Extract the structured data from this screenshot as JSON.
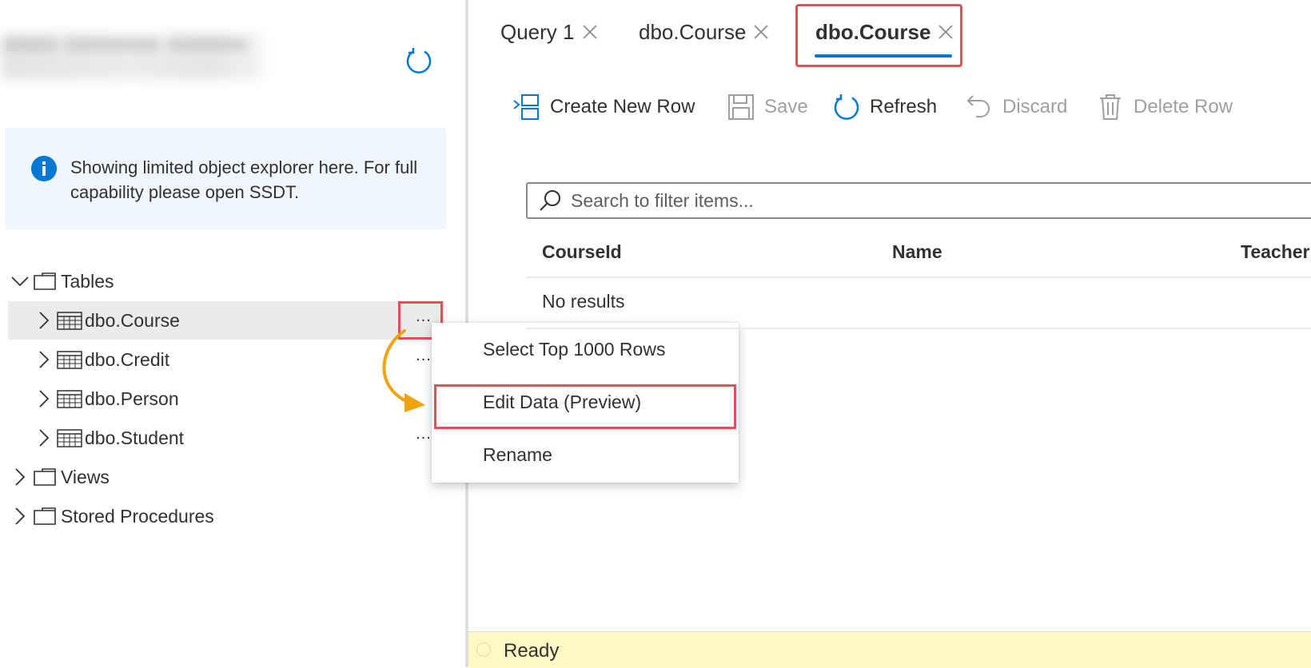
{
  "explorer": {
    "info_message": "Showing limited object explorer here. For full capability please open SSDT.",
    "tree": {
      "tables_label": "Tables",
      "tables": [
        "dbo.Course",
        "dbo.Credit",
        "dbo.Person",
        "dbo.Student"
      ],
      "views_label": "Views",
      "procedures_label": "Stored Procedures",
      "more_label": "..."
    }
  },
  "context_menu": {
    "items": [
      "Select Top 1000 Rows",
      "Edit Data (Preview)",
      "Rename"
    ]
  },
  "tabs": [
    {
      "label": "Query 1"
    },
    {
      "label": "dbo.Course"
    },
    {
      "label": "dbo.Course",
      "active": true
    }
  ],
  "toolbar": {
    "create_label": "Create New Row",
    "save_label": "Save",
    "refresh_label": "Refresh",
    "discard_label": "Discard",
    "delete_label": "Delete Row"
  },
  "grid": {
    "search_placeholder": "Search to filter items...",
    "columns": [
      "CourseId",
      "Name",
      "Teacher"
    ],
    "empty_text": "No results"
  },
  "status": {
    "text": "Ready"
  },
  "colors": {
    "accent": "#0078d4",
    "highlight": "#e74c57",
    "arrow": "#f0a30a",
    "status_bar": "#fff9c6",
    "info_box": "#eff6fc"
  },
  "icons": {
    "refresh": "refresh-icon",
    "info": "info-icon",
    "table": "table-icon",
    "folder": "folder-icon"
  }
}
